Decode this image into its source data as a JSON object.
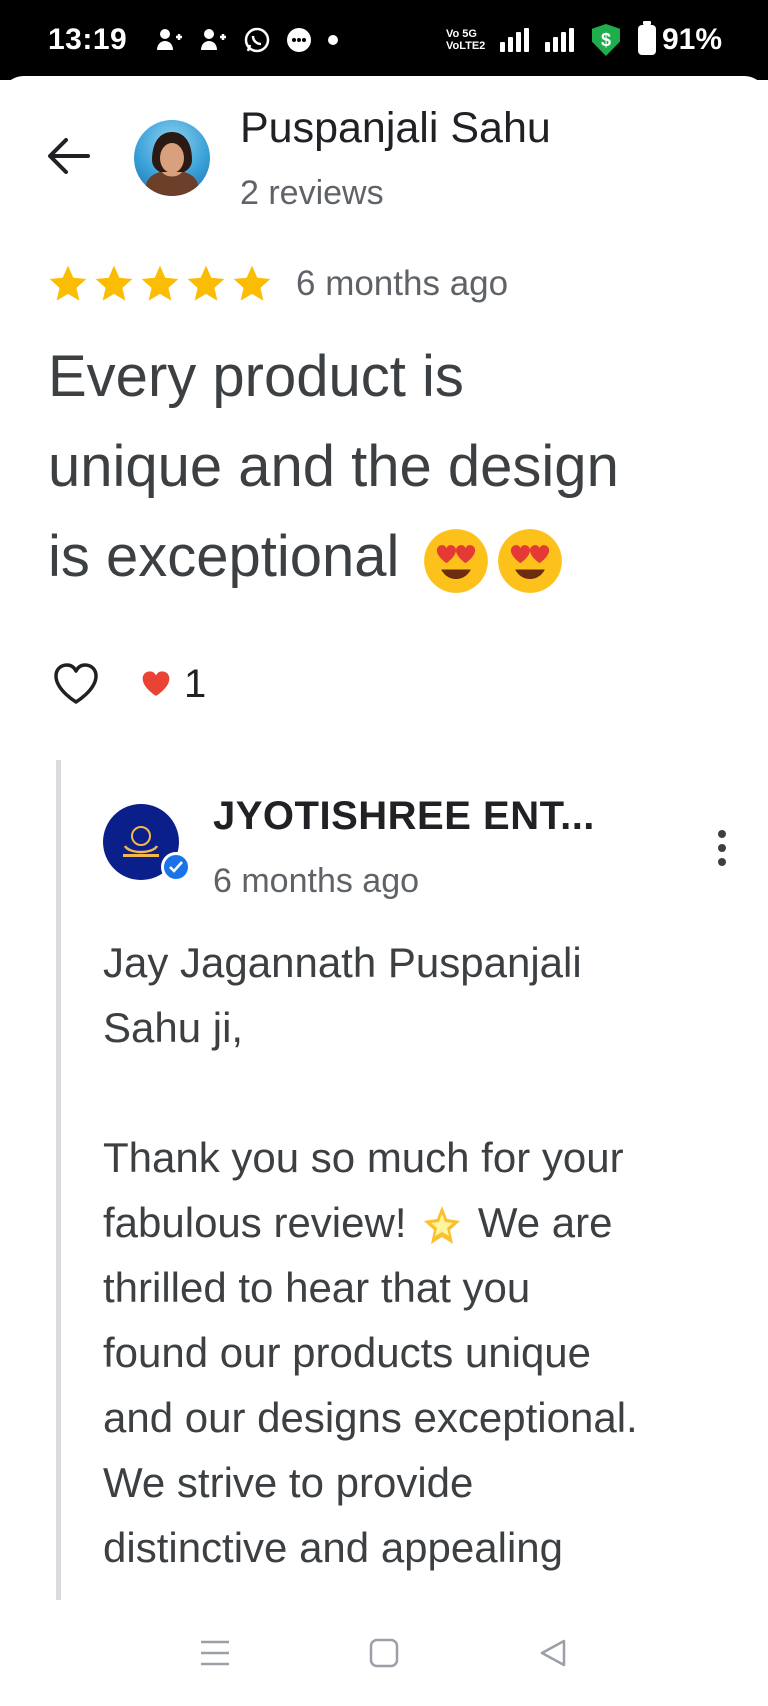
{
  "status_bar": {
    "time": "13:19",
    "network_label_top": "Vo 5G",
    "network_label_bottom": "VoLTE2",
    "battery": "91%",
    "icons": [
      "person-add-icon",
      "person-add-icon",
      "whatsapp-icon",
      "chat-bubble-icon",
      "dot-icon",
      "signal-icon",
      "signal-icon",
      "shield-dollar-icon",
      "battery-icon"
    ]
  },
  "header": {
    "reviewer_name": "Puspanjali Sahu",
    "reviewer_reviews": "2 reviews"
  },
  "review": {
    "rating": 5,
    "time_ago": "6 months ago",
    "text_line1": "Every product is",
    "text_line2": "unique and the design",
    "text_line3": "is exceptional",
    "emojis": [
      "heart-eyes-emoji",
      "heart-eyes-emoji"
    ],
    "like_count": "1",
    "star_color": "#fbbc04",
    "heart_color": "#ea4335"
  },
  "owner_reply": {
    "owner_name": "JYOTISHREE ENT...",
    "time_ago": "6 months ago",
    "greeting_line1": "Jay Jagannath Puspanjali",
    "greeting_line2": "Sahu ji,",
    "body_line1": "Thank you so much for your",
    "body_line2_a": "fabulous review!",
    "body_line2_b": "We are",
    "body_line3": "thrilled to hear that you",
    "body_line4": "found our products unique",
    "body_line5": "and our designs exceptional.",
    "body_line6": "We strive to provide",
    "body_line7": "distinctive and appealing"
  },
  "nav_bar": {
    "buttons": [
      "menu-icon",
      "home-square-icon",
      "back-triangle-icon"
    ]
  }
}
